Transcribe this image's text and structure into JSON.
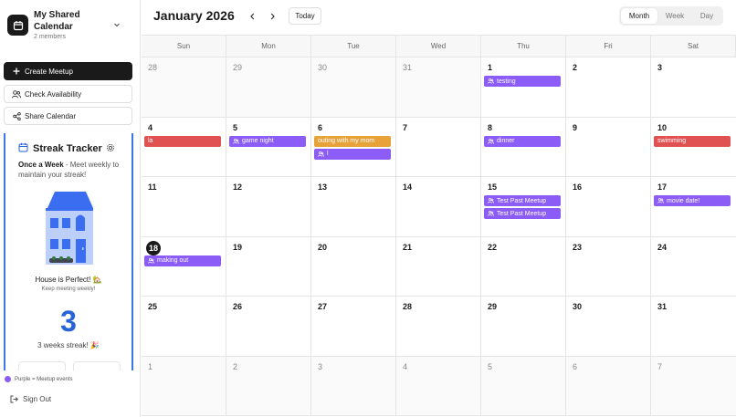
{
  "colors": {
    "purple": "#8b5cf6",
    "red": "#e05252",
    "orange": "#e8a23a",
    "accent": "#2563d6"
  },
  "sidebar": {
    "calendar_name": "My Shared Calendar",
    "members": "2 members",
    "create_meetup": "Create Meetup",
    "check_availability": "Check Availability",
    "share_calendar": "Share Calendar",
    "streak": {
      "title": "Streak Tracker",
      "frequency": "Once a Week",
      "description": " - Meet weekly to maintain your streak!",
      "house_status": "House is Perfect! 🏡",
      "house_sub": "Keep meeting weekly!",
      "count": "3",
      "weeks_label": "3 weeks streak! 🎉"
    },
    "legend": "Purple = Meetup events",
    "sign_out": "Sign Out"
  },
  "header": {
    "month_title": "January 2026",
    "today": "Today",
    "views": [
      "Month",
      "Week",
      "Day"
    ],
    "active_view": "Month"
  },
  "weekdays": [
    "Sun",
    "Mon",
    "Tue",
    "Wed",
    "Thu",
    "Fri",
    "Sat"
  ],
  "weeks": [
    [
      {
        "day": "28",
        "out": true
      },
      {
        "day": "29",
        "out": true
      },
      {
        "day": "30",
        "out": true
      },
      {
        "day": "31",
        "out": true
      },
      {
        "day": "1",
        "events": [
          {
            "title": "testing",
            "color": "purple",
            "meetup": true
          }
        ]
      },
      {
        "day": "2"
      },
      {
        "day": "3"
      }
    ],
    [
      {
        "day": "4",
        "events": [
          {
            "title": "la",
            "color": "red",
            "meetup": false
          }
        ]
      },
      {
        "day": "5",
        "events": [
          {
            "title": "game night",
            "color": "purple",
            "meetup": true
          }
        ]
      },
      {
        "day": "6",
        "events": [
          {
            "title": "outing with my mom",
            "color": "orange",
            "meetup": false
          },
          {
            "title": "l",
            "color": "purple",
            "meetup": true
          }
        ]
      },
      {
        "day": "7"
      },
      {
        "day": "8",
        "events": [
          {
            "title": "dinner",
            "color": "purple",
            "meetup": true
          }
        ]
      },
      {
        "day": "9"
      },
      {
        "day": "10",
        "events": [
          {
            "title": "swimming",
            "color": "red",
            "meetup": false
          }
        ]
      }
    ],
    [
      {
        "day": "11"
      },
      {
        "day": "12"
      },
      {
        "day": "13"
      },
      {
        "day": "14"
      },
      {
        "day": "15",
        "events": [
          {
            "title": "Test Past Meetup",
            "color": "purple",
            "meetup": true
          },
          {
            "title": "Test Past Meetup",
            "color": "purple",
            "meetup": true
          }
        ]
      },
      {
        "day": "16"
      },
      {
        "day": "17",
        "events": [
          {
            "title": "movie date!",
            "color": "purple",
            "meetup": true
          }
        ]
      }
    ],
    [
      {
        "day": "18",
        "today": true,
        "events": [
          {
            "title": "making out",
            "color": "purple",
            "meetup": true
          }
        ]
      },
      {
        "day": "19"
      },
      {
        "day": "20"
      },
      {
        "day": "21"
      },
      {
        "day": "22"
      },
      {
        "day": "23"
      },
      {
        "day": "24"
      }
    ],
    [
      {
        "day": "25"
      },
      {
        "day": "26"
      },
      {
        "day": "27"
      },
      {
        "day": "28"
      },
      {
        "day": "29"
      },
      {
        "day": "30"
      },
      {
        "day": "31"
      }
    ],
    [
      {
        "day": "1",
        "out": true
      },
      {
        "day": "2",
        "out": true
      },
      {
        "day": "3",
        "out": true
      },
      {
        "day": "4",
        "out": true
      },
      {
        "day": "5",
        "out": true
      },
      {
        "day": "6",
        "out": true
      },
      {
        "day": "7",
        "out": true
      }
    ]
  ]
}
